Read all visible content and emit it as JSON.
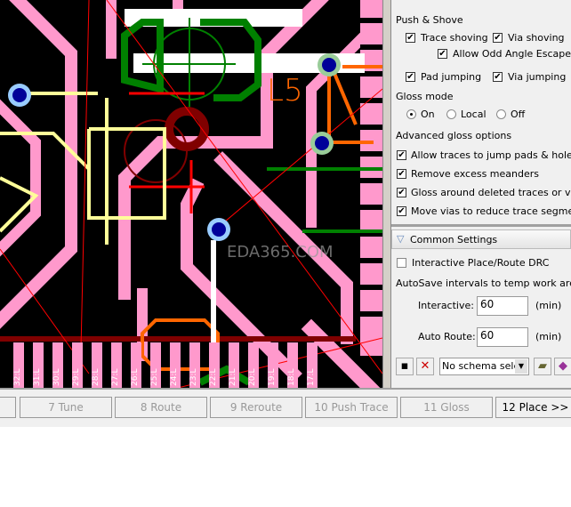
{
  "canvas": {
    "layer_label": "L5",
    "watermark": "EDA365.COM",
    "pin_labels": [
      "32:L",
      "31:L",
      "30:L",
      "29:L",
      "28:L",
      "27:L",
      "26:L",
      "25:L",
      "24:L",
      "23:L",
      "22:L",
      "21:L",
      "20:L",
      "19:L",
      "18:L",
      "17:L"
    ]
  },
  "push_shove": {
    "title": "Push & Shove",
    "trace_shoving": {
      "label": "Trace shoving",
      "checked": true
    },
    "via_shoving": {
      "label": "Via shoving",
      "checked": true
    },
    "odd_angle": {
      "label": "Allow Odd Angle Escape",
      "checked": true
    },
    "pad_jumping": {
      "label": "Pad jumping",
      "checked": true
    },
    "via_jumping": {
      "label": "Via jumping",
      "checked": true
    }
  },
  "gloss_mode": {
    "title": "Gloss mode",
    "options": [
      "On",
      "Local",
      "Off"
    ],
    "selected": "On"
  },
  "advanced_gloss": {
    "title": "Advanced gloss options",
    "items": [
      {
        "label": "Allow traces to jump pads & holes",
        "checked": true
      },
      {
        "label": "Remove excess meanders",
        "checked": true
      },
      {
        "label": "Gloss around deleted traces or vias",
        "checked": true
      },
      {
        "label": "Move vias to reduce trace segments",
        "checked": true
      }
    ]
  },
  "common": {
    "title": "Common Settings",
    "drc": {
      "label": "Interactive Place/Route DRC",
      "checked": false
    },
    "autosave_label": "AutoSave intervals to temp work area",
    "interactive": {
      "label": "Interactive:",
      "value": "60",
      "unit": "(min)"
    },
    "autoroute": {
      "label": "Auto Route:",
      "value": "60",
      "unit": "(min)"
    },
    "schema": "No schema selec"
  },
  "steps": [
    "7 Tune",
    "8 Route",
    "9 Reroute",
    "10 Push Trace",
    "11 Gloss",
    "12 Place >>"
  ]
}
